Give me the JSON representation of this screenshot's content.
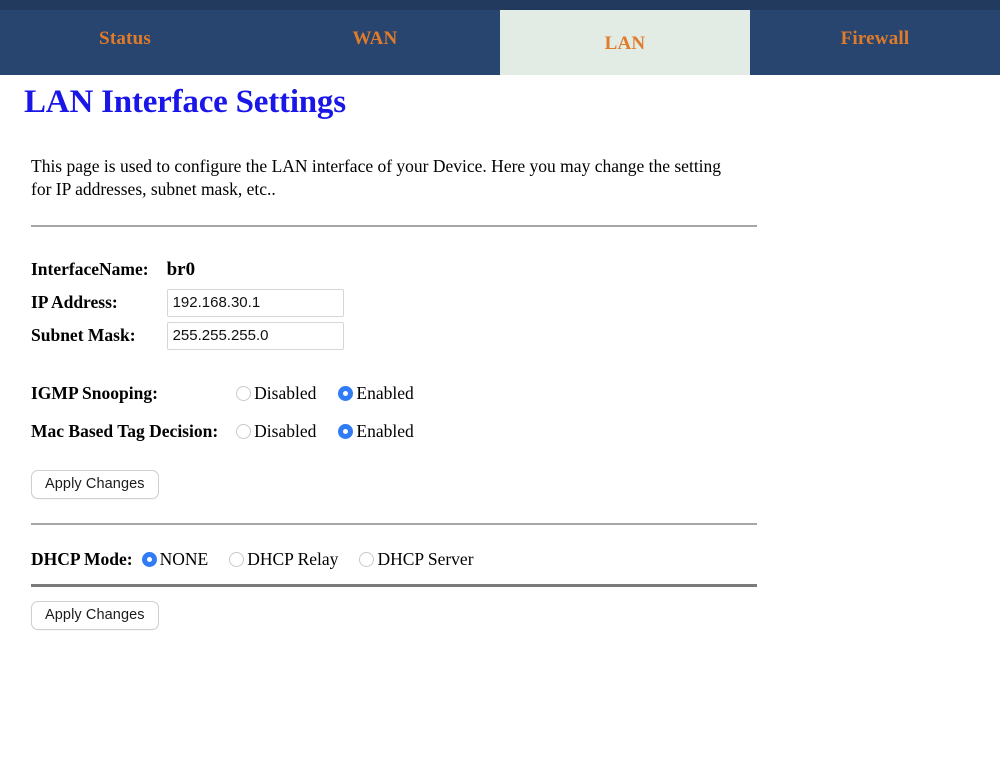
{
  "nav": {
    "tabs": [
      {
        "label": "Status",
        "active": false
      },
      {
        "label": "WAN",
        "active": false
      },
      {
        "label": "LAN",
        "active": true
      },
      {
        "label": "Firewall",
        "active": false
      }
    ],
    "bg_color": "#28456f",
    "active_bg_color": "#e2ece5",
    "link_color": "#e07b2a"
  },
  "page": {
    "title": "LAN Interface Settings",
    "title_color": "#1a16e8",
    "intro": "This page is used to configure the LAN interface of your Device. Here you may change the setting for IP addresses, subnet mask, etc.."
  },
  "form": {
    "interface_name": {
      "label": "InterfaceName:",
      "value": "br0"
    },
    "ip_address": {
      "label": "IP Address:",
      "value": "192.168.30.1"
    },
    "subnet_mask": {
      "label": "Subnet Mask:",
      "value": "255.255.255.0"
    },
    "igmp_snooping": {
      "label": "IGMP Snooping:",
      "options": [
        {
          "label": "Disabled",
          "selected": false
        },
        {
          "label": "Enabled",
          "selected": true
        }
      ]
    },
    "mac_based_tag_decision": {
      "label": "Mac Based Tag Decision:",
      "options": [
        {
          "label": "Disabled",
          "selected": false
        },
        {
          "label": "Enabled",
          "selected": true
        }
      ]
    },
    "apply_top": "Apply Changes",
    "dhcp_mode": {
      "label": "DHCP Mode:",
      "options": [
        {
          "label": "NONE",
          "selected": true
        },
        {
          "label": "DHCP Relay",
          "selected": false
        },
        {
          "label": "DHCP Server",
          "selected": false
        }
      ]
    },
    "apply_bottom": "Apply Changes",
    "radio_selected_color": "#2f7cf6"
  }
}
